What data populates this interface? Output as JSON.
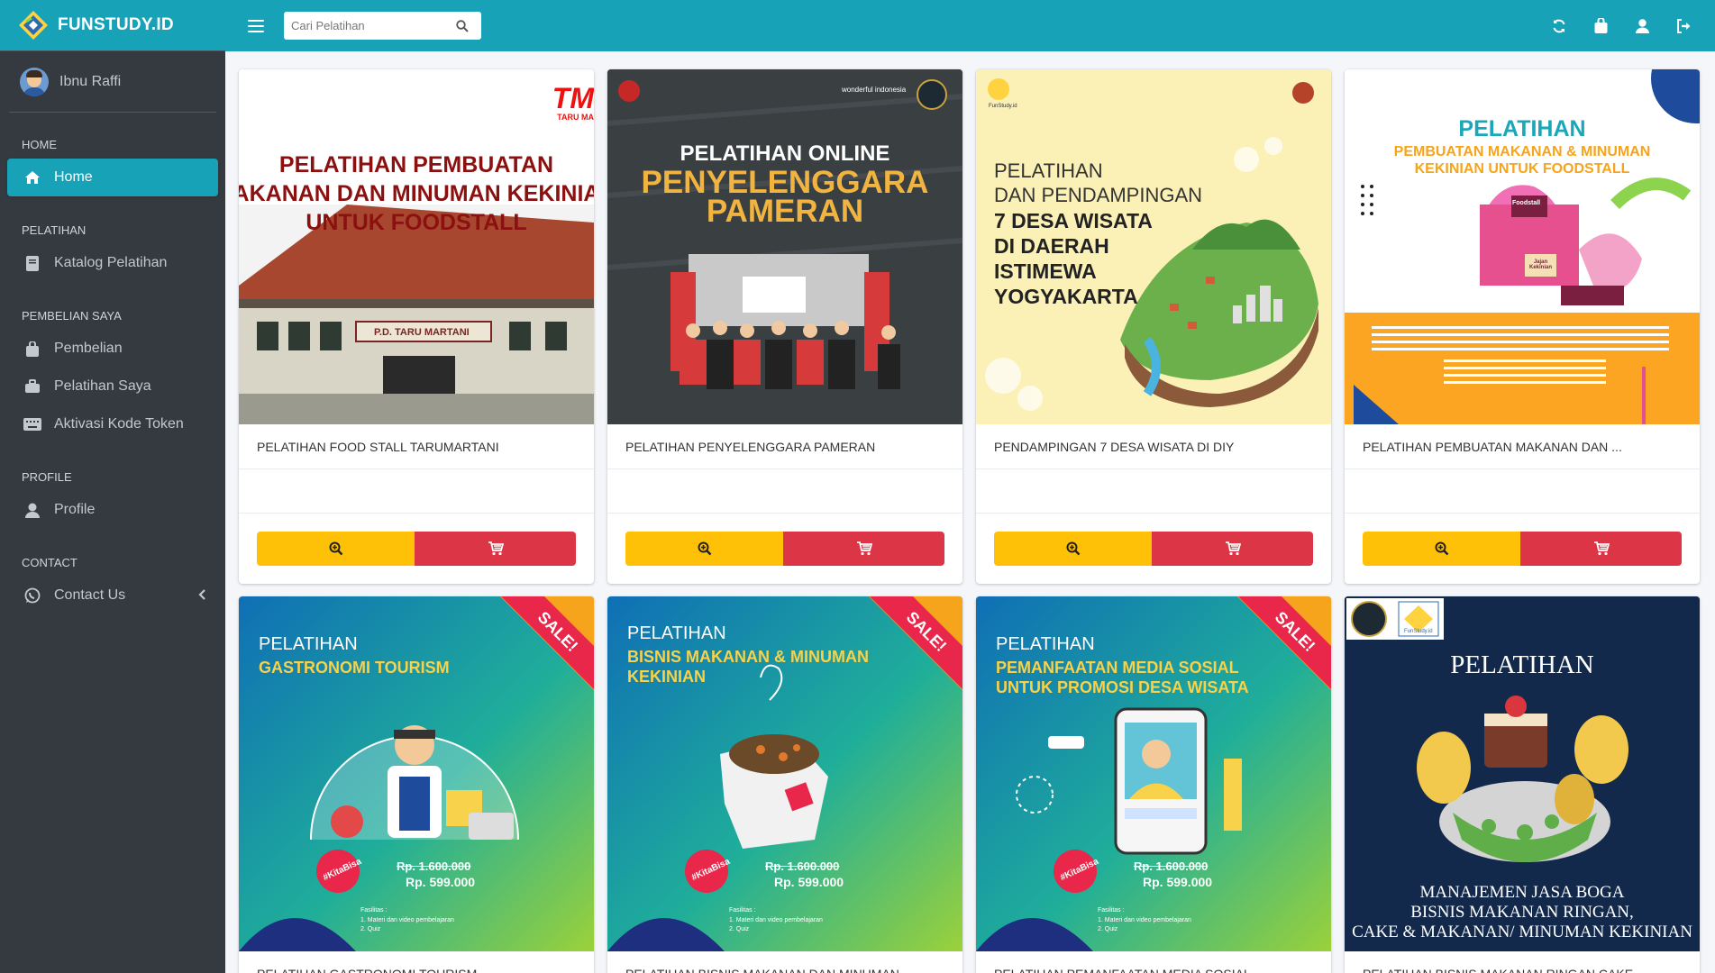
{
  "brand": {
    "name": "FUNSTUDY.ID"
  },
  "user": {
    "name": "Ibnu Raffi"
  },
  "sidebar": {
    "sections": [
      {
        "header": "HOME",
        "items": [
          {
            "label": "Home",
            "icon": "home-icon",
            "active": true
          }
        ]
      },
      {
        "header": "PELATIHAN",
        "items": [
          {
            "label": "Katalog Pelatihan",
            "icon": "book-icon"
          }
        ]
      },
      {
        "header": "PEMBELIAN SAYA",
        "items": [
          {
            "label": "Pembelian",
            "icon": "shopping-bag-icon"
          },
          {
            "label": "Pelatihan Saya",
            "icon": "briefcase-icon"
          },
          {
            "label": "Aktivasi Kode Token",
            "icon": "keyboard-icon"
          }
        ]
      },
      {
        "header": "PROFILE",
        "items": [
          {
            "label": "Profile",
            "icon": "user-icon"
          }
        ]
      },
      {
        "header": "CONTACT",
        "items": [
          {
            "label": "Contact Us",
            "icon": "whatsapp-icon"
          }
        ]
      }
    ]
  },
  "search": {
    "placeholder": "Cari Pelatihan"
  },
  "header_icons": [
    "refresh-icon",
    "shopping-bag-icon",
    "user-icon",
    "logout-icon"
  ],
  "cards": [
    {
      "title": "PELATIHAN FOOD STALL TARUMARTANI",
      "image": {
        "line1": "PELATIHAN PEMBUATAN",
        "line2": "AKANAN DAN MINUMAN KEKINIA",
        "line3": "UNTUK FOODSTALL",
        "logo": "TM",
        "logo_sub": "TARU MA",
        "sign": "P.D. TARU MARTANI"
      }
    },
    {
      "title": "PELATIHAN PENYELENGGARA PAMERAN",
      "image": {
        "line1": "PELATIHAN ONLINE",
        "line2": "PENYELENGGARA",
        "line3": "PAMERAN",
        "logo": "wonderful indonesia"
      }
    },
    {
      "title": "PENDAMPINGAN 7 DESA WISATA DI DIY",
      "image": {
        "line1": "PELATIHAN",
        "line2": "DAN PENDAMPINGAN",
        "line3": "7 DESA WISATA",
        "line4": "DI DAERAH",
        "line5": "ISTIMEWA",
        "line6": "YOGYAKARTA",
        "logo": "FunStudy.id"
      }
    },
    {
      "title": "PELATIHAN PEMBUATAN MAKANAN DAN ...",
      "image": {
        "line1": "PELATIHAN",
        "line2": "PEMBUATAN MAKANAN & MINUMAN",
        "line3": "KEKINIAN UNTUK FOODSTALL",
        "stall": "Foodstall",
        "stall2": "Jajan Kekinian"
      }
    },
    {
      "title": "PELATIHAN GASTRONOMI TOURISM",
      "image": {
        "line1": "PELATIHAN",
        "line2": "GASTRONOMI TOURISM",
        "line3": "",
        "sale": "SALE!",
        "old_price": "Rp. 1.600.000",
        "price": "Rp. 599.000",
        "tag": "#KitaBisa",
        "facil": "Fasilitas :",
        "facil1": "1. Materi dan video pembelajaran",
        "facil2": "2. Quiz"
      }
    },
    {
      "title": "PELATIHAN BISNIS MAKANAN DAN MINUMAN",
      "image": {
        "line1": "PELATIHAN",
        "line2": "BISNIS MAKANAN & MINUMAN",
        "line3": "KEKINIAN",
        "sale": "SALE!",
        "old_price": "Rp. 1.600.000",
        "price": "Rp. 599.000",
        "tag": "#KitaBisa",
        "facil": "Fasilitas :",
        "facil1": "1. Materi dan video pembelajaran",
        "facil2": "2. Quiz"
      }
    },
    {
      "title": "PELATIHAN PEMANFAATAN MEDIA SOSIAL",
      "image": {
        "line1": "PELATIHAN",
        "line2": "PEMANFAATAN MEDIA SOSIAL",
        "line3": "UNTUK PROMOSI DESA WISATA",
        "sale": "SALE!",
        "old_price": "Rp. 1.600.000",
        "price": "Rp. 599.000",
        "tag": "#KitaBisa",
        "facil": "Fasilitas :",
        "facil1": "1. Materi dan video pembelajaran",
        "facil2": "2. Quiz"
      }
    },
    {
      "title": "PELATIHAN BISNIS MAKANAN RINGAN CAKE",
      "image": {
        "line1": "PELATIHAN",
        "line2": "MANAJEMEN JASA BOGA",
        "line3": "BISNIS MAKANAN RINGAN,",
        "line4": "CAKE & MAKANAN/ MINUMAN KEKINIAN",
        "logo": "FunStudy.id"
      }
    }
  ],
  "colors": {
    "primary": "#17a2b8",
    "sidebar": "#343a40",
    "view_button": "#ffc107",
    "cart_button": "#dc3545"
  }
}
